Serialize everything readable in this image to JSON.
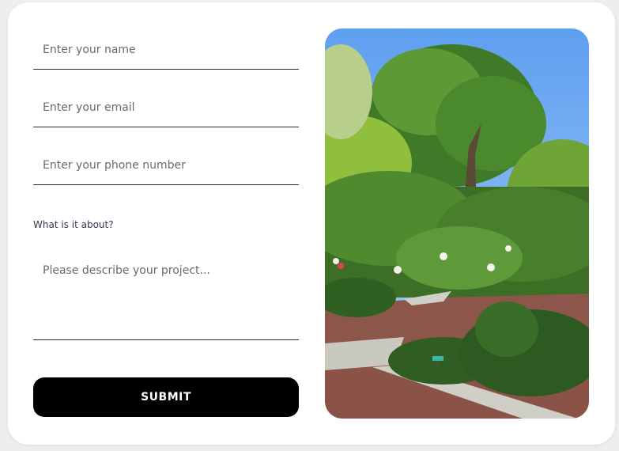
{
  "form": {
    "name_placeholder": "Enter your name",
    "email_placeholder": "Enter your email",
    "phone_placeholder": "Enter your phone number",
    "about_label": "What is it about?",
    "description_placeholder": "Please describe your project...",
    "submit_label": "SUBMIT"
  },
  "colors": {
    "button_background": "#000000",
    "card_background": "#ffffff",
    "page_background": "#eeeeef"
  }
}
